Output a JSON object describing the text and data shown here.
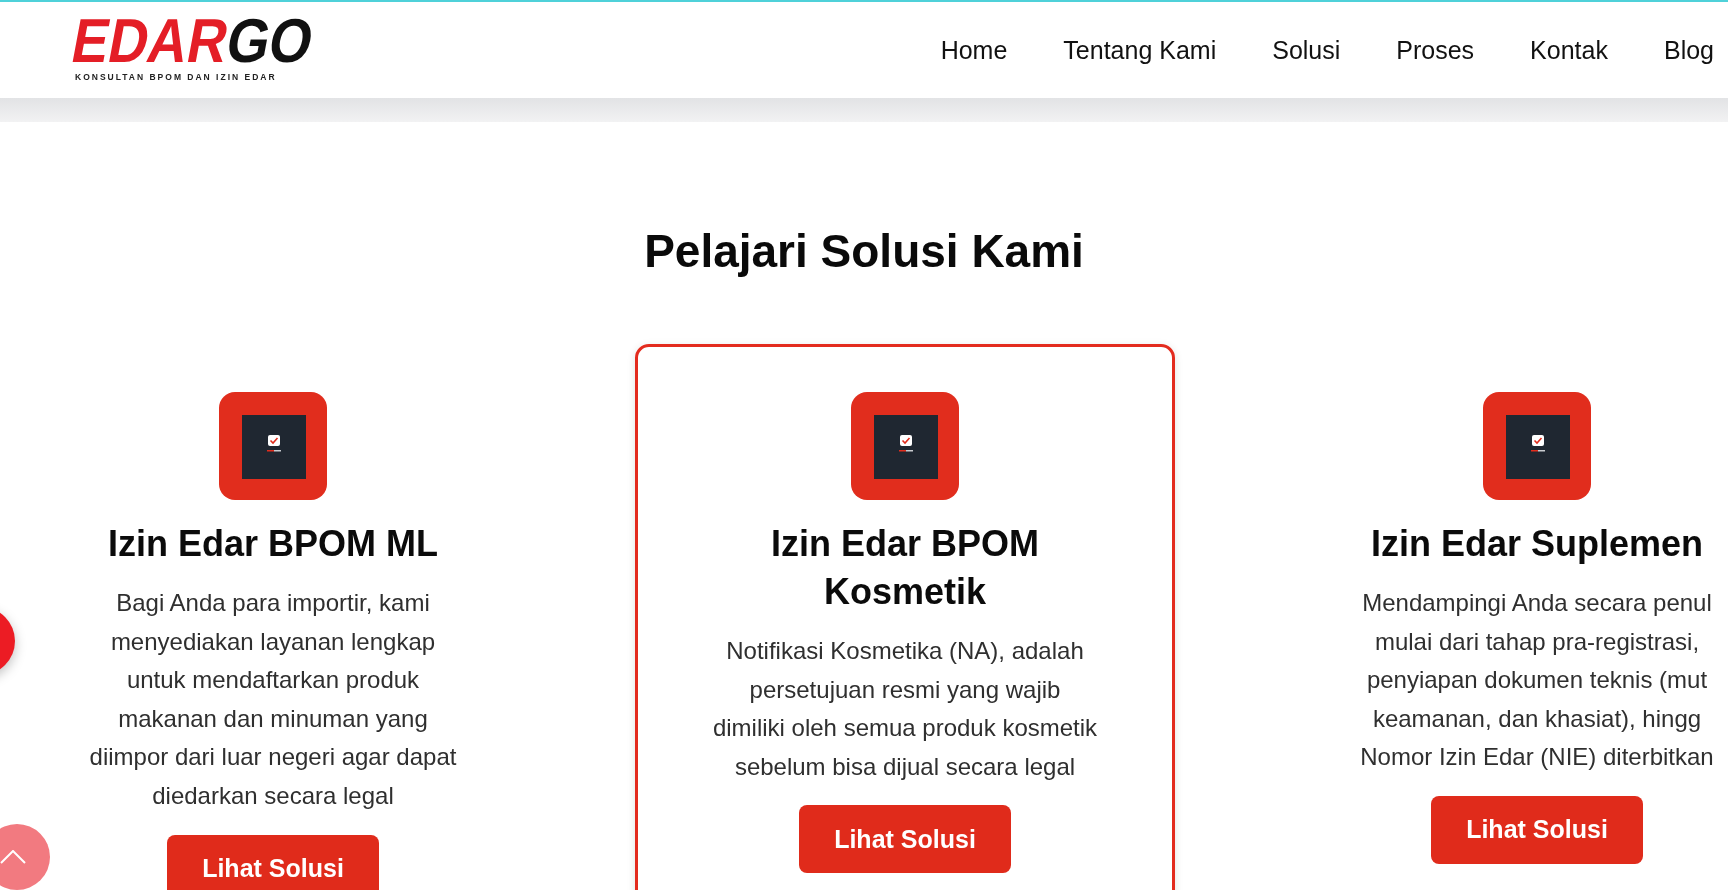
{
  "header": {
    "logo": {
      "accent_text": "EDAR",
      "text": "GO",
      "tagline": "KONSULTAN BPOM DAN IZIN EDAR"
    },
    "nav": [
      "Home",
      "Tentang Kami",
      "Solusi",
      "Proses",
      "Kontak",
      "Blog"
    ]
  },
  "section": {
    "title": "Pelajari Solusi Kami",
    "cards": [
      {
        "title": "Izin Edar BPOM ML",
        "description_lines": [
          "Bagi Anda para importir, kami",
          "menyediakan layanan lengkap",
          "untuk mendaftarkan produk",
          "makanan dan minuman yang",
          "diimpor dari luar negeri agar dapat",
          "diedarkan secara legal"
        ],
        "button": "Lihat Solusi",
        "highlighted": false
      },
      {
        "title": "Izin Edar BPOM Kosmetik",
        "description_lines": [
          "Notifikasi Kosmetika (NA), adalah",
          "persetujuan resmi yang wajib",
          "dimiliki oleh semua produk kosmetik",
          "sebelum bisa dijual secara legal"
        ],
        "button": "Lihat Solusi",
        "highlighted": true
      },
      {
        "title": "Izin Edar Suplemen",
        "description_lines": [
          "Mendampingi Anda secara penul",
          "mulai dari tahap pra-registrasi,",
          "penyiapan dokumen teknis (mut",
          "keamanan, dan khasiat), hingg",
          "Nomor Izin Edar (NIE) diterbitkan"
        ],
        "button": "Lihat Solusi",
        "highlighted": false
      }
    ]
  }
}
